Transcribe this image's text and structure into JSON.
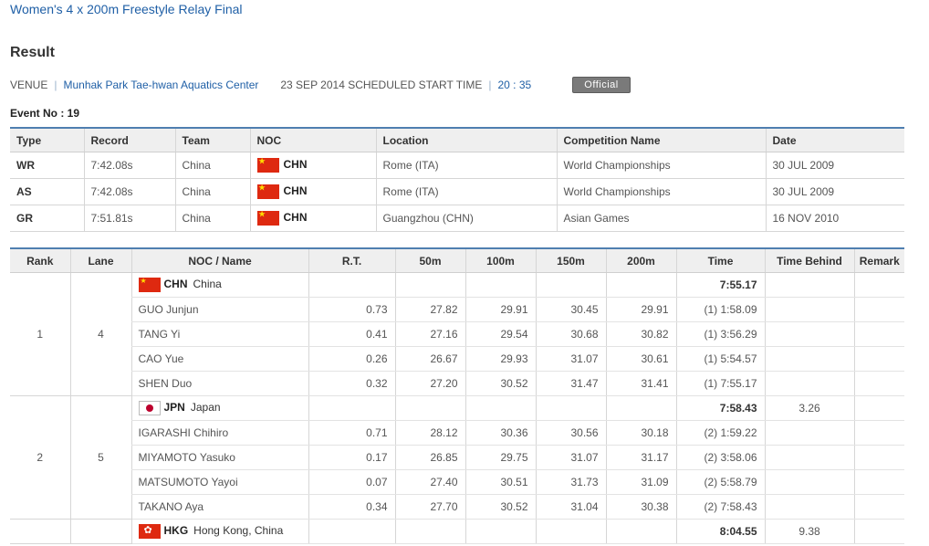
{
  "event": {
    "title": "Women's 4 x 200m Freestyle Relay Final",
    "section": "Result",
    "venue_label": "VENUE",
    "venue": "Munhak Park Tae-hwan Aquatics Center",
    "date_text": "23 SEP 2014 SCHEDULED START TIME",
    "start_time": "20 : 35",
    "status": "Official",
    "event_no": "Event No : 19"
  },
  "records": {
    "headers": [
      "Type",
      "Record",
      "Team",
      "NOC",
      "Location",
      "Competition Name",
      "Date"
    ],
    "rows": [
      {
        "type": "WR",
        "record": "7:42.08s",
        "team": "China",
        "noc": "CHN",
        "flag": "flag-chn",
        "location": "Rome (ITA)",
        "competition": "World Championships",
        "date": "30 JUL 2009"
      },
      {
        "type": "AS",
        "record": "7:42.08s",
        "team": "China",
        "noc": "CHN",
        "flag": "flag-chn",
        "location": "Rome (ITA)",
        "competition": "World Championships",
        "date": "30 JUL 2009"
      },
      {
        "type": "GR",
        "record": "7:51.81s",
        "team": "China",
        "noc": "CHN",
        "flag": "flag-chn",
        "location": "Guangzhou (CHN)",
        "competition": "Asian Games",
        "date": "16 NOV 2010"
      }
    ]
  },
  "results": {
    "headers": [
      "Rank",
      "Lane",
      "NOC / Name",
      "R.T.",
      "50m",
      "100m",
      "150m",
      "200m",
      "Time",
      "Time Behind",
      "Remark"
    ],
    "teams": [
      {
        "rank": "1",
        "lane": "4",
        "noc": "CHN",
        "country": "China",
        "flag": "flag-chn",
        "time": "7:55.17",
        "behind": "",
        "remark": "",
        "swimmers": [
          {
            "name": "GUO Junjun",
            "rt": "0.73",
            "s50": "27.82",
            "s100": "29.91",
            "s150": "30.45",
            "s200": "29.91",
            "time": "(1) 1:58.09"
          },
          {
            "name": "TANG Yi",
            "rt": "0.41",
            "s50": "27.16",
            "s100": "29.54",
            "s150": "30.68",
            "s200": "30.82",
            "time": "(1) 3:56.29"
          },
          {
            "name": "CAO Yue",
            "rt": "0.26",
            "s50": "26.67",
            "s100": "29.93",
            "s150": "31.07",
            "s200": "30.61",
            "time": "(1) 5:54.57"
          },
          {
            "name": "SHEN Duo",
            "rt": "0.32",
            "s50": "27.20",
            "s100": "30.52",
            "s150": "31.47",
            "s200": "31.41",
            "time": "(1) 7:55.17"
          }
        ]
      },
      {
        "rank": "2",
        "lane": "5",
        "noc": "JPN",
        "country": "Japan",
        "flag": "flag-jpn",
        "time": "7:58.43",
        "behind": "3.26",
        "remark": "",
        "swimmers": [
          {
            "name": "IGARASHI Chihiro",
            "rt": "0.71",
            "s50": "28.12",
            "s100": "30.36",
            "s150": "30.56",
            "s200": "30.18",
            "time": "(2) 1:59.22"
          },
          {
            "name": "MIYAMOTO Yasuko",
            "rt": "0.17",
            "s50": "26.85",
            "s100": "29.75",
            "s150": "31.07",
            "s200": "31.17",
            "time": "(2) 3:58.06"
          },
          {
            "name": "MATSUMOTO Yayoi",
            "rt": "0.07",
            "s50": "27.40",
            "s100": "30.51",
            "s150": "31.73",
            "s200": "31.09",
            "time": "(2) 5:58.79"
          },
          {
            "name": "TAKANO Aya",
            "rt": "0.34",
            "s50": "27.70",
            "s100": "30.52",
            "s150": "31.04",
            "s200": "30.38",
            "time": "(2) 7:58.43"
          }
        ]
      },
      {
        "rank": "",
        "lane": "",
        "noc": "HKG",
        "country": "Hong Kong, China",
        "flag": "flag-hkg",
        "time": "8:04.55",
        "behind": "9.38",
        "remark": "",
        "swimmers": []
      }
    ]
  }
}
